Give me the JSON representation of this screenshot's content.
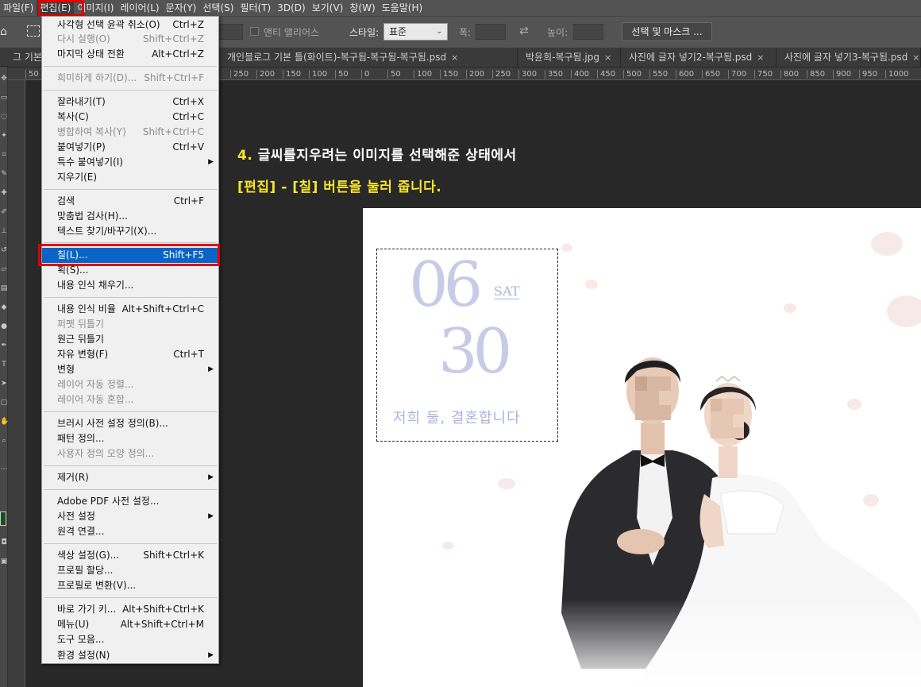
{
  "menubar": {
    "items": [
      "파일(F)",
      "편집(E)",
      "이미지(I)",
      "레이어(L)",
      "문자(Y)",
      "선택(S)",
      "필터(T)",
      "3D(D)",
      "보기(V)",
      "창(W)",
      "도움말(H)"
    ]
  },
  "options": {
    "antialias_label": "앤티 앨리어스",
    "style_label": "스타일:",
    "style_value": "표준",
    "width_label": "폭:",
    "height_label": "높이:",
    "select_mask_button": "선택 및 마스크 ..."
  },
  "tabs": [
    {
      "label": "그 기본"
    },
    {
      "label": "개인블로그 기본 틀(화이트)-복구됨-복구됨-복구됨.psd",
      "close": "×"
    },
    {
      "label": "박윤희-복구됨.jpg",
      "close": "×"
    },
    {
      "label": "사진에 글자 넣기2-복구됨.psd",
      "close": "×"
    },
    {
      "label": "사진에 글자 넣기3-복구됨.psd",
      "close": "×"
    }
  ],
  "ruler": {
    "left_numbers": [
      "50"
    ],
    "numbers": [
      "250",
      "200",
      "150",
      "100",
      "50",
      "0",
      "50",
      "100",
      "150",
      "200",
      "250",
      "300",
      "350",
      "400",
      "450",
      "500",
      "550",
      "600",
      "650",
      "700",
      "750",
      "800",
      "850",
      "900",
      "950",
      "1000"
    ]
  },
  "edit_menu": {
    "items": [
      {
        "label": "사각형 선택 윤곽 취소(O)",
        "shortcut": "Ctrl+Z",
        "disabled": false
      },
      {
        "label": "다시 실행(O)",
        "shortcut": "Shift+Ctrl+Z",
        "disabled": true
      },
      {
        "label": "마지막 상태 전환",
        "shortcut": "Alt+Ctrl+Z",
        "disabled": false
      },
      {
        "label": "희미하게 하기(D)...",
        "shortcut": "Shift+Ctrl+F",
        "disabled": true
      },
      {
        "label": "잘라내기(T)",
        "shortcut": "Ctrl+X",
        "disabled": false
      },
      {
        "label": "복사(C)",
        "shortcut": "Ctrl+C",
        "disabled": false
      },
      {
        "label": "병합하여 복사(Y)",
        "shortcut": "Shift+Ctrl+C",
        "disabled": true
      },
      {
        "label": "붙여넣기(P)",
        "shortcut": "Ctrl+V",
        "disabled": false
      },
      {
        "label": "특수 붙여넣기(I)",
        "shortcut": "",
        "disabled": false,
        "submenu": true
      },
      {
        "label": "지우기(E)",
        "shortcut": "",
        "disabled": false
      },
      {
        "label": "검색",
        "shortcut": "Ctrl+F",
        "disabled": false
      },
      {
        "label": "맞춤법 검사(H)...",
        "shortcut": "",
        "disabled": false
      },
      {
        "label": "텍스트 찾기/바꾸기(X)...",
        "shortcut": "",
        "disabled": false
      },
      {
        "label": "칠(L)...",
        "shortcut": "Shift+F5",
        "disabled": false,
        "highlighted": true
      },
      {
        "label": "획(S)...",
        "shortcut": "",
        "disabled": false
      },
      {
        "label": "내용 인식 채우기...",
        "shortcut": "",
        "disabled": false
      },
      {
        "label": "내용 인식 비율",
        "shortcut": "Alt+Shift+Ctrl+C",
        "disabled": false
      },
      {
        "label": "퍼펫 뒤틀기",
        "shortcut": "",
        "disabled": true
      },
      {
        "label": "원근 뒤틀기",
        "shortcut": "",
        "disabled": false
      },
      {
        "label": "자유 변형(F)",
        "shortcut": "Ctrl+T",
        "disabled": false
      },
      {
        "label": "변형",
        "shortcut": "",
        "disabled": false,
        "submenu": true
      },
      {
        "label": "레이어 자동 정렬...",
        "shortcut": "",
        "disabled": true
      },
      {
        "label": "레이어 자동 혼합...",
        "shortcut": "",
        "disabled": true
      },
      {
        "label": "브러시 사전 설정 정의(B)...",
        "shortcut": "",
        "disabled": false
      },
      {
        "label": "패턴 정의...",
        "shortcut": "",
        "disabled": false
      },
      {
        "label": "사용자 정의 모양 정의...",
        "shortcut": "",
        "disabled": true
      },
      {
        "label": "제거(R)",
        "shortcut": "",
        "disabled": false,
        "submenu": true
      },
      {
        "label": "Adobe PDF 사전 설정...",
        "shortcut": "",
        "disabled": false
      },
      {
        "label": "사전 설정",
        "shortcut": "",
        "disabled": false,
        "submenu": true
      },
      {
        "label": "원격 연결...",
        "shortcut": "",
        "disabled": false
      },
      {
        "label": "색상 설정(G)...",
        "shortcut": "Shift+Ctrl+K",
        "disabled": false
      },
      {
        "label": "프로필 할당...",
        "shortcut": "",
        "disabled": false
      },
      {
        "label": "프로필로 변환(V)...",
        "shortcut": "",
        "disabled": false
      },
      {
        "label": "바로 가기 키...",
        "shortcut": "Alt+Shift+Ctrl+K",
        "disabled": false
      },
      {
        "label": "메뉴(U)",
        "shortcut": "Alt+Shift+Ctrl+M",
        "disabled": false
      },
      {
        "label": "도구 모음...",
        "shortcut": "",
        "disabled": false
      },
      {
        "label": "환경 설정(N)",
        "shortcut": "",
        "disabled": false,
        "submenu": true
      }
    ]
  },
  "instructions": {
    "line1_num": "4.",
    "line1_text": " 글씨를지우려는 이미지를 선택해준 상태에서",
    "line2_text": "[편집] - [칠] 버튼을 눌러 줍니다."
  },
  "design": {
    "day": "06",
    "weekday": "SAT",
    "date": "30",
    "tagline": "저희 둘, 결혼합니다"
  },
  "colors": {
    "highlight_red": "#e00000",
    "menu_selection": "#0a64c8",
    "caption_yellow": "#f5e52e",
    "design_lavender": "#c6cce6"
  }
}
